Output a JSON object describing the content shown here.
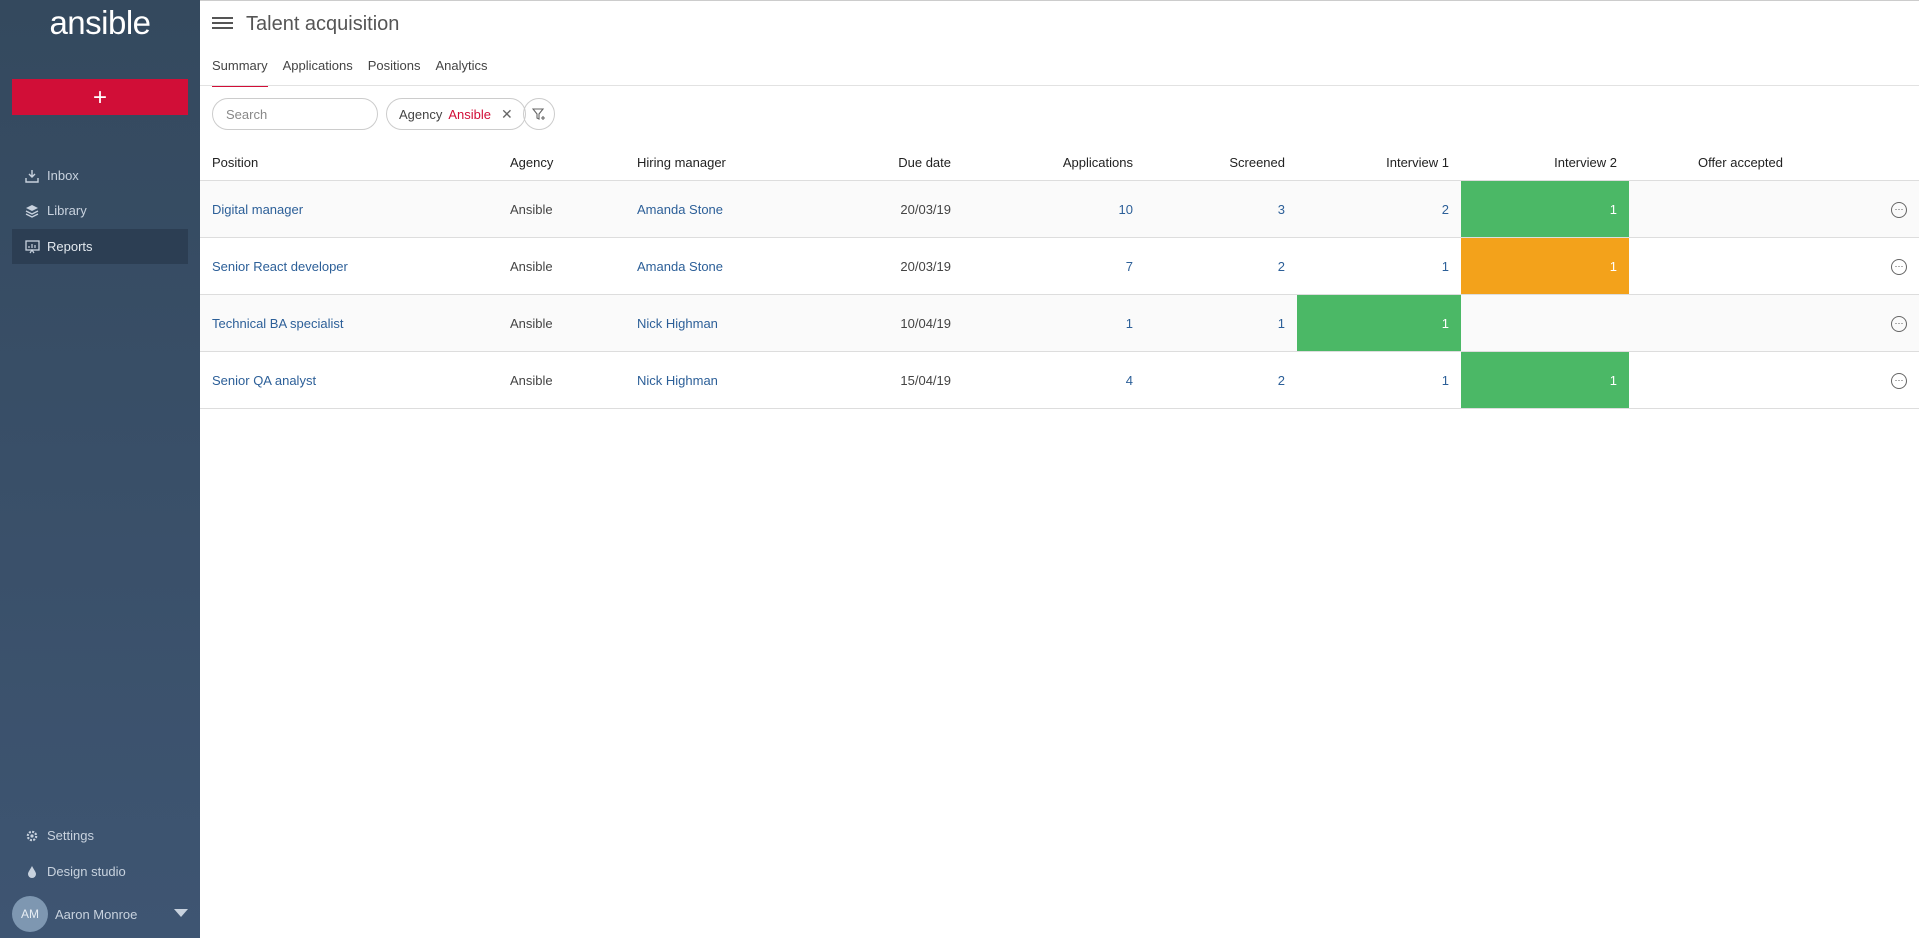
{
  "sidebar": {
    "logo": "ansible",
    "add_label": "+",
    "nav": [
      {
        "label": "Inbox",
        "icon": "inbox-icon"
      },
      {
        "label": "Library",
        "icon": "layers-icon"
      },
      {
        "label": "Reports",
        "icon": "reports-icon",
        "active": true
      }
    ],
    "bottom": [
      {
        "label": "Settings",
        "icon": "gear-icon"
      },
      {
        "label": "Design studio",
        "icon": "drop-icon"
      }
    ],
    "user": {
      "initials": "AM",
      "name": "Aaron Monroe"
    }
  },
  "header": {
    "title": "Talent acquisition",
    "tabs": [
      "Summary",
      "Applications",
      "Positions",
      "Analytics"
    ],
    "active_tab": "Summary"
  },
  "filters": {
    "search_placeholder": "Search",
    "chip_key": "Agency",
    "chip_value": "Ansible",
    "chip_close": "✕"
  },
  "table": {
    "columns": [
      "Position",
      "Agency",
      "Hiring manager",
      "Due date",
      "Applications",
      "Screened",
      "Interview 1",
      "Interview 2",
      "Offer accepted"
    ],
    "rows": [
      {
        "position": "Digital manager",
        "agency": "Ansible",
        "manager": "Amanda Stone",
        "due": "20/03/19",
        "applications": "10",
        "screened": "3",
        "interview1": "2",
        "interview2": "1",
        "offer": ""
      },
      {
        "position": "Senior React developer",
        "agency": "Ansible",
        "manager": "Amanda Stone",
        "due": "20/03/19",
        "applications": "7",
        "screened": "2",
        "interview1": "1",
        "interview2": "1",
        "offer": ""
      },
      {
        "position": "Technical BA specialist",
        "agency": "Ansible",
        "manager": "Nick Highman",
        "due": "10/04/19",
        "applications": "1",
        "screened": "1",
        "interview1": "1",
        "interview2": "",
        "offer": ""
      },
      {
        "position": "Senior QA analyst",
        "agency": "Ansible",
        "manager": "Nick Highman",
        "due": "15/04/19",
        "applications": "4",
        "screened": "2",
        "interview1": "1",
        "interview2": "1",
        "offer": ""
      }
    ],
    "more_icon": "···"
  },
  "colors": {
    "accent": "#d10e37",
    "status_green": "#4bb866",
    "status_orange": "#f3a21b",
    "sidebar": "#34495e",
    "link": "#2c5f98"
  }
}
